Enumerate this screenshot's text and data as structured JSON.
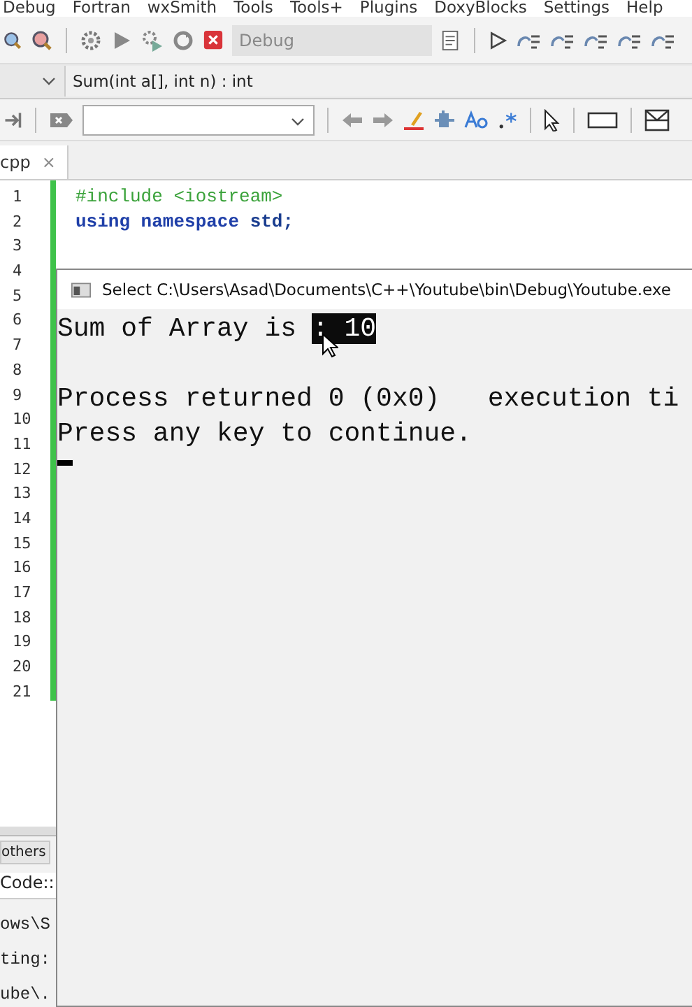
{
  "menu": [
    "Debug",
    "Fortran",
    "wxSmith",
    "Tools",
    "Tools+",
    "Plugins",
    "DoxyBlocks",
    "Settings",
    "Help"
  ],
  "toolbar": {
    "build_target": "Debug",
    "build_target_disabled": true
  },
  "function_bar": {
    "signature": "Sum(int a[], int n) : int"
  },
  "editor": {
    "tab": {
      "label": "cpp",
      "close": "×",
      "selected": true
    },
    "line_numbers": [
      "1",
      "2",
      "3",
      "4",
      "5",
      "6",
      "7",
      "8",
      "9",
      "10",
      "11",
      "12",
      "13",
      "14",
      "15",
      "16",
      "17",
      "18",
      "19",
      "20",
      "21"
    ],
    "code": [
      [
        {
          "text": "#include <iostream>",
          "kind": "preprocessor"
        }
      ],
      [
        {
          "text": "using namespace ",
          "kind": "keyword"
        },
        {
          "text": "std;",
          "kind": "identifier"
        }
      ]
    ]
  },
  "console": {
    "title": "Select C:\\Users\\Asad\\Documents\\C++\\Youtube\\bin\\Debug\\Youtube.exe",
    "lines": [
      [
        {
          "text": "Sum of Array is ",
          "selected": false
        },
        {
          "text": ": 10",
          "selected": true
        }
      ],
      [
        {
          "text": "Process returned 0 (0x0)   execution ti",
          "selected": false
        }
      ],
      [
        {
          "text": "Press any key to continue.",
          "selected": false
        }
      ]
    ]
  },
  "bottom_panel": {
    "tab": "others",
    "header": "Code::",
    "log": [
      "ows\\S",
      "ting:",
      "ube\\."
    ]
  }
}
